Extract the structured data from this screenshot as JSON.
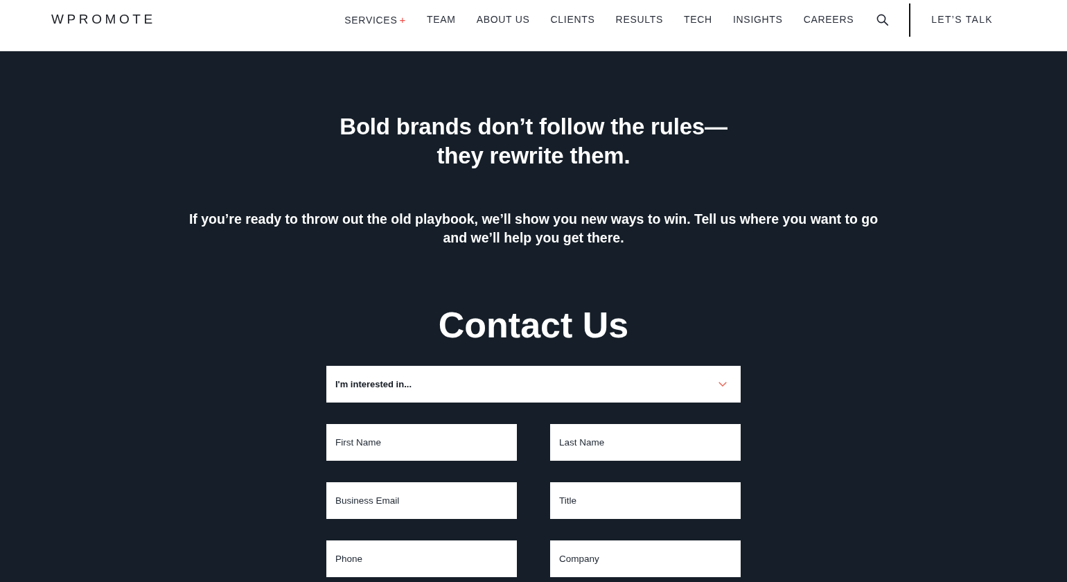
{
  "header": {
    "logo": "WPROMOTE",
    "nav": [
      {
        "label": "SERVICES",
        "suffix": "+"
      },
      {
        "label": "TEAM"
      },
      {
        "label": "ABOUT US"
      },
      {
        "label": "CLIENTS"
      },
      {
        "label": "RESULTS"
      },
      {
        "label": "TECH"
      },
      {
        "label": "INSIGHTS"
      },
      {
        "label": "CAREERS"
      }
    ],
    "cta": "LET’S TALK"
  },
  "hero": {
    "headline": [
      "Bold brands don’t follow the rules—",
      "they rewrite them."
    ],
    "intro": [
      "If you’re ready to throw out the old playbook, we’ll show you new ways to win. Tell us where you want to go",
      "and we’ll help you get there."
    ]
  },
  "contact": {
    "title": "Contact Us",
    "fields": [
      {
        "kind": "select",
        "placeholder": "I'm interested in..."
      },
      {
        "kind": "text",
        "placeholder": "First Name"
      },
      {
        "kind": "text",
        "placeholder": "Last Name"
      },
      {
        "kind": "text",
        "placeholder": "Business Email"
      },
      {
        "kind": "text",
        "placeholder": "Title"
      },
      {
        "kind": "text",
        "placeholder": "Phone"
      },
      {
        "kind": "text",
        "placeholder": "Company"
      }
    ]
  }
}
